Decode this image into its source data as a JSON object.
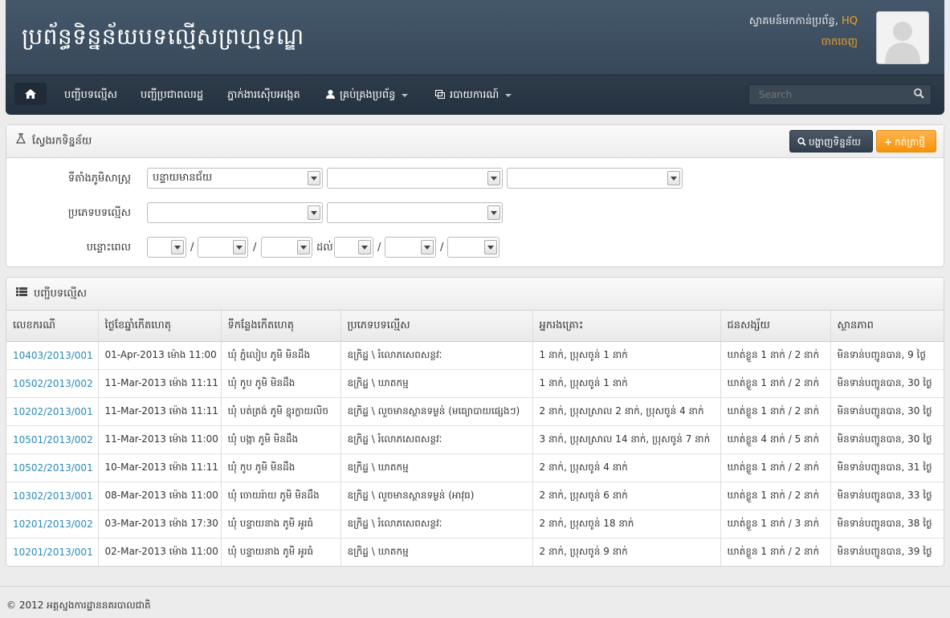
{
  "header": {
    "title": "ប្រព័ន្ធទិន្នន័យបទល្មើសព្រហ្មទណ្ឌ",
    "welcome_text": "ស្វាគមន៍មកកាន់ប្រព័ន្ធ,",
    "user_name": "HQ",
    "logout": "ចាកចេញ"
  },
  "nav": {
    "items": [
      {
        "label": "បញ្ជីបទល្មើស"
      },
      {
        "label": "បញ្ជីប្រជាពលរដ្ឋ"
      },
      {
        "label": "ភ្នាក់ងារស៊ើបអង្កេត"
      },
      {
        "label": "គ្រប់គ្រងប្រព័ន្ធ"
      },
      {
        "label": "របាយការណ៍"
      }
    ],
    "search_placeholder": "Search"
  },
  "search_panel": {
    "title": "ស្វែងរកទិន្នន័យ",
    "show_button": "បង្ហាញទិន្នន័យ",
    "add_button": "កត់ត្រាថ្មី",
    "location_label": "ទីតាំងភូមិសាស្ត្រ",
    "province_value": "បន្ទាយមានជ័យ",
    "crime_type_label": "ប្រភេទបទល្មើស",
    "period_label": "បន្លោះពេល",
    "to_label": "ដល់",
    "date_sep": "/"
  },
  "list_panel": {
    "title": "បញ្ជីបទល្មើស",
    "columns": [
      "លេខករណី",
      "ថ្ងៃខែឆ្នាំកើតហេតុ",
      "ទីកន្លែងកើតហេតុ",
      "ប្រភេទបទល្មើស",
      "អ្នករងគ្រោះ",
      "ជនសង្ស័យ",
      "ស្ថានភាព"
    ],
    "rows": [
      [
        "10403/2013/001",
        "01-Apr-2013 ម៉ោង 11:00",
        "ឃុំ ភ្នំលៀប ភូមិ មិនដឹង",
        "ឧក្រិដ្ឋ \\ រំលោភសេពសន្ថវៈ",
        "1 នាក់, ប្រុសចូន់ 1 នាក់",
        "ឃាត់ខ្លួន 1 នាក់ / 2 នាក់",
        "មិនទាន់បញ្ជូនបាន, 9 ថ្ងៃ"
      ],
      [
        "10502/2013/002",
        "11-Mar-2013 ម៉ោង 11:11",
        "ឃុំ កូប ភូមិ មិនដឹង",
        "ឧក្រិដ្ឋ \\ ឃាតកម្ម",
        "1 នាក់, ប្រុសចូន់ 1 នាក់",
        "ឃាត់ខ្លួន 1 នាក់ / 2 នាក់",
        "មិនទាន់បញ្ជូនបាន, 30 ថ្ងៃ"
      ],
      [
        "10202/2013/001",
        "11-Mar-2013 ម៉ោង 11:11",
        "ឃុំ បត់ត្រង់ ភូមិ ខ្នុរក្លាយលិច",
        "ឧក្រិដ្ឋ \\ លួចមានស្ថានទម្ងន់ (មធ្យោបាយផ្សេងៗ)",
        "2 នាក់, ប្រុសស្រាល 2 នាក់, ប្រុសចូន់ 4 នាក់",
        "ឃាត់ខ្លួន 1 នាក់ / 2 នាក់",
        "មិនទាន់បញ្ជូនបាន, 30 ថ្ងៃ"
      ],
      [
        "10501/2013/002",
        "11-Mar-2013 ម៉ោង 11:00",
        "ឃុំ បង្កា ភូមិ មិនដឹង",
        "ឧក្រិដ្ឋ \\ រំលោភសេពសន្ថវៈ",
        "3 នាក់, ប្រុសស្រាល 14 នាក់, ប្រុសចូន់ 7 នាក់",
        "ឃាត់ខ្លួន 4 នាក់ / 5 នាក់",
        "មិនទាន់បញ្ជូនបាន, 30 ថ្ងៃ"
      ],
      [
        "10502/2013/001",
        "10-Mar-2013 ម៉ោង 11:11",
        "ឃុំ កូប ភូមិ មិនដឹង",
        "ឧក្រិដ្ឋ \\ ឃាតកម្ម",
        "2 នាក់, ប្រុសចូន់ 4 នាក់",
        "ឃាត់ខ្លួន 1 នាក់ / 2 នាក់",
        "មិនទាន់បញ្ជូនបាន, 31 ថ្ងៃ"
      ],
      [
        "10302/2013/001",
        "08-Mar-2013 ម៉ោង 11:00",
        "ឃុំ ចោយរ៉ាយ ភូមិ មិនដឹង",
        "ឧក្រិដ្ឋ \\ លួចមានស្ថានទម្ងន់ (អាវុធ)",
        "2 នាក់, ប្រុសចូន់ 6 នាក់",
        "ឃាត់ខ្លួន 1 នាក់ / 2 នាក់",
        "មិនទាន់បញ្ជូនបាន, 33 ថ្ងៃ"
      ],
      [
        "10201/2013/002",
        "03-Mar-2013 ម៉ោង 17:30",
        "ឃុំ បន្ទាយនាង ភូមិ អូរធំ",
        "ឧក្រិដ្ឋ \\ រំលោភសេពសន្ថវៈ",
        "2 នាក់, ប្រុសចូន់ 18 នាក់",
        "ឃាត់ខ្លួន 1 នាក់ / 3 នាក់",
        "មិនទាន់បញ្ជូនបាន, 38 ថ្ងៃ"
      ],
      [
        "10201/2013/001",
        "02-Mar-2013 ម៉ោង 11:00",
        "ឃុំ បន្ទាយនាង ភូមិ អូរធំ",
        "ឧក្រិដ្ឋ \\ ឃាតកម្ម",
        "2 នាក់, ប្រុសចូន់ 9 នាក់",
        "ឃាត់ខ្លួន 1 នាក់ / 2 នាក់",
        "មិនទាន់បញ្ជូនបាន, 39 ថ្ងៃ"
      ]
    ]
  },
  "footer": {
    "text": "© 2012 អគ្គស្នងការដ្ឋាននគរបាលជាតិ"
  },
  "colors": {
    "accent": "#f0a32a",
    "link": "#2a88b8",
    "header_bg": "#3b4b5c"
  }
}
